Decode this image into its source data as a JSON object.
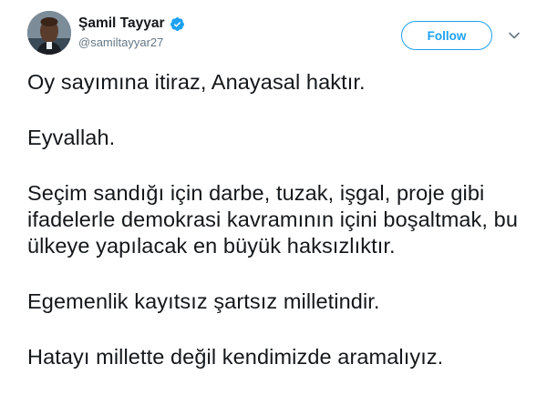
{
  "user": {
    "display_name": "Şamil Tayyar",
    "handle": "@samiltayyar27",
    "verified": true
  },
  "actions": {
    "follow_label": "Follow"
  },
  "icons": {
    "verified": "verified-badge-icon",
    "caret": "chevron-down-icon",
    "avatar": "user-avatar"
  },
  "colors": {
    "accent": "#1da1f2",
    "text": "#14171a",
    "secondary": "#657786"
  },
  "tweet": {
    "paragraphs": [
      "Oy sayımına itiraz, Anayasal haktır.",
      "Eyvallah.",
      "Seçim sandığı için darbe, tuzak, işgal, proje gibi ifadelerle demokrasi kavramının içini boşaltmak, bu ülkeye yapılacak en büyük haksızlıktır.",
      "Egemenlik kayıtsız şartsız milletindir.",
      "Hatayı millette değil kendimizde aramalıyız."
    ]
  }
}
